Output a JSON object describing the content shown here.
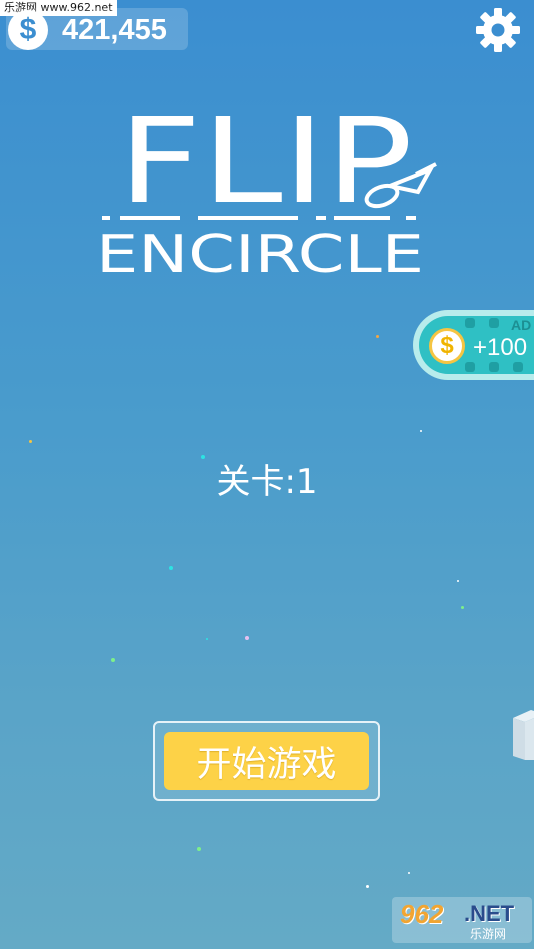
{
  "watermark_top": "乐游网 www.962.net",
  "wallet": {
    "icon": "dollar-coin-icon",
    "symbol": "$",
    "coins": "421,455"
  },
  "settings": {
    "icon": "gear-icon"
  },
  "logo": {
    "line1": "FLIP",
    "line2": "ENCIRCLE"
  },
  "ad_reward": {
    "tag": "AD",
    "symbol": "$",
    "amount": "+100",
    "icon": "dollar-coin-icon"
  },
  "level": {
    "text": "关卡:1"
  },
  "start_button": {
    "label": "开始游戏"
  },
  "watermark_bottom": {
    "brand": "962",
    "suffix": ".NET",
    "sub": "乐游网"
  },
  "colors": {
    "background_top": "#3b8ed0",
    "background_bottom": "#64aac6",
    "start_button": "#fdd247",
    "ad_pill": "#2fc0c4",
    "ad_coin": "#f0b400"
  }
}
